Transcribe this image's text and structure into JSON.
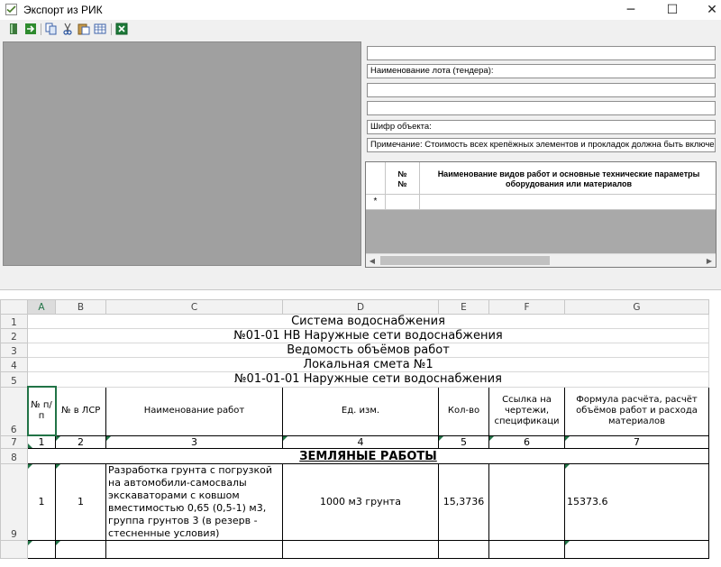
{
  "window": {
    "title": "Экспорт из РИК",
    "minimize_glyph": "─",
    "maximize_glyph": "☐",
    "close_glyph": "✕"
  },
  "toolbar": {
    "icons": [
      "book-icon",
      "export-arrow-icon",
      "copy-icon",
      "cut-icon",
      "paste-icon",
      "table-icon",
      "excel-icon"
    ]
  },
  "form": {
    "field1": "",
    "lot_name": "Наименование лота (тендера):",
    "field3": "",
    "field4": "",
    "object_code": "Шифр объекта:",
    "note": "Примечание: Стоимость всех крепёжных элементов и прокладок должна быть включена по во"
  },
  "grid": {
    "col_no": "№\n№",
    "col_name_line1": "Наименование видов работ и основные технические параметры",
    "col_name_line2": "оборудования или материалов",
    "new_row_marker": "*"
  },
  "sheet": {
    "columns": [
      "A",
      "B",
      "C",
      "D",
      "E",
      "F",
      "G"
    ],
    "rows": [
      "1",
      "2",
      "3",
      "4",
      "5",
      "6",
      "7",
      "8",
      "9"
    ],
    "titles": [
      "Система водоснабжения",
      "№01-01 НВ Наружные сети водоснабжения",
      "Ведомость объёмов работ",
      "Локальная смета №1",
      "№01-01-01 Наружные сети водоснабжения"
    ],
    "headers": [
      "№ п/п",
      "№ в ЛСР",
      "Наименование работ",
      "Ед. изм.",
      "Кол-во",
      "Ссылка на чертежи, спецификаци",
      "Формула расчёта, расчёт объёмов работ и расхода материалов"
    ],
    "numbers": [
      "1",
      "2",
      "3",
      "4",
      "5",
      "6",
      "7"
    ],
    "section": "ЗЕМЛЯНЫЕ РАБОТЫ",
    "row9": {
      "no": "1",
      "lsr": "1",
      "name": "Разработка грунта с погрузкой на автомобили-самосвалы экскаваторами с ковшом вместимостью 0,65 (0,5-1) м3, группа грунтов 3 (в резерв - стесненные условия)",
      "unit": "1000 м3 грунта",
      "qty": "15,3736",
      "ref": "",
      "formula": "15373.6"
    }
  },
  "colors": {
    "accent": "#217346",
    "preview_bg": "#a0a0a0",
    "window_bg": "#f0f0f0"
  }
}
